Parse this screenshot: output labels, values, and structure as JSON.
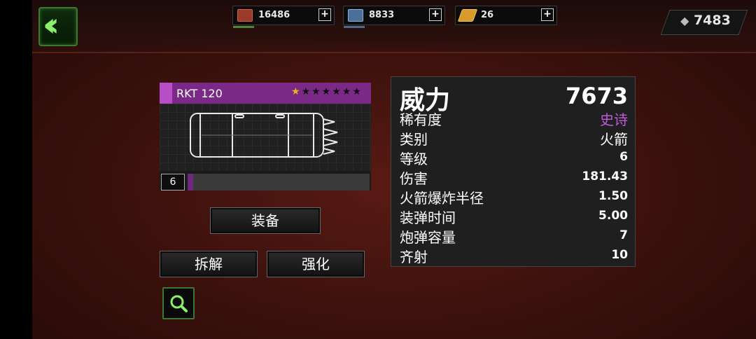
{
  "colors": {
    "rarity_epic": "#c05ad8",
    "accent_green": "#8cf06a",
    "xp_fill": "#6c2a7c"
  },
  "topbar": {
    "back_icon": "double-chevron-left-icon",
    "resources": [
      {
        "icon": "red-crate-icon",
        "value": "16486"
      },
      {
        "icon": "blue-crate-icon",
        "value": "8833"
      },
      {
        "icon": "gold-bar-icon",
        "value": "26"
      }
    ],
    "plus_label": "+",
    "gems": {
      "icon": "gem-icon",
      "value": "7483"
    }
  },
  "card": {
    "name": "RKT 120",
    "stars_filled": 1,
    "stars_total": 7,
    "level": "6",
    "xp_progress": 0.03,
    "image_icon": "rocket-pod-icon"
  },
  "buttons": {
    "equip": "装备",
    "dismantle": "拆解",
    "enhance": "强化",
    "zoom_icon": "magnifier-icon"
  },
  "stats": {
    "power_label": "威力",
    "power_value": "7673",
    "rows": [
      {
        "label": "稀有度",
        "value": "史诗"
      },
      {
        "label": "类别",
        "value": "火箭"
      },
      {
        "label": "等级",
        "value": "6"
      },
      {
        "label": "伤害",
        "value": "181.43"
      },
      {
        "label": "火箭爆炸半径",
        "value": "1.50"
      },
      {
        "label": "装弹时间",
        "value": "5.00"
      },
      {
        "label": "炮弹容量",
        "value": "7"
      },
      {
        "label": "齐射",
        "value": "10"
      }
    ]
  }
}
